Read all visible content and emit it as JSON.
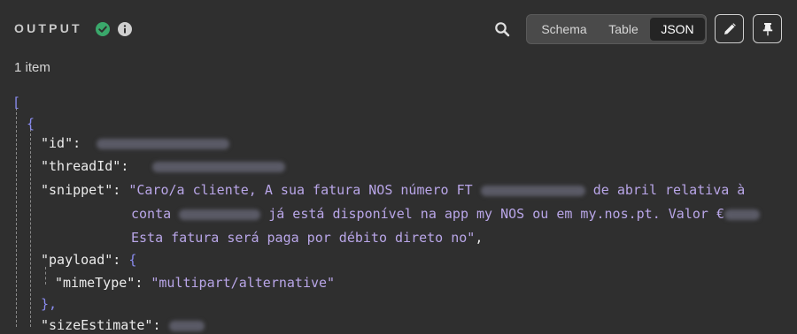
{
  "header": {
    "title": "OUTPUT",
    "views": [
      "Schema",
      "Table",
      "JSON"
    ],
    "active_view": "JSON"
  },
  "item_count": "1 item",
  "json": {
    "open_array": "[",
    "open_object": "{",
    "k_id": "\"id\"",
    "k_threadId": "\"threadId\"",
    "k_snippet": "\"snippet\"",
    "snippet_1a": "\"Caro/a cliente, A sua fatura NOS número FT",
    "snippet_1b": "de abril relativa à",
    "snippet_2a": "conta",
    "snippet_2b": "já está disponível na app my NOS ou em my.nos.pt. Valor €",
    "snippet_3": "Esta fatura será paga por débito direto no\"",
    "k_payload": "\"payload\"",
    "payload_open": "{",
    "k_mimeType": "\"mimeType\"",
    "mimeType": "\"multipart/alternative\"",
    "payload_close": "},",
    "k_sizeEstimate": "\"sizeEstimate\"",
    "colon": ":",
    "comma": ","
  },
  "colors": {
    "accent_ok": "#3aa86b",
    "bracket": "#8a8cf0",
    "string": "#b9a6e8"
  }
}
